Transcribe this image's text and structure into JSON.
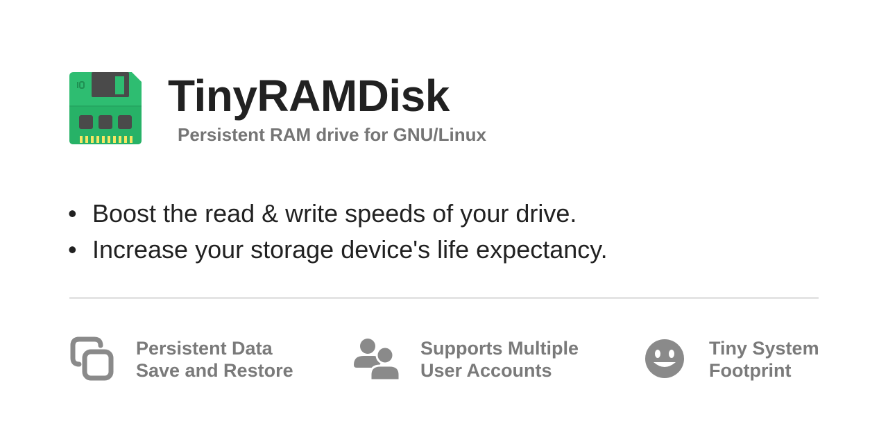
{
  "app": {
    "title": "TinyRAMDisk",
    "subtitle": "Persistent RAM drive for GNU/Linux",
    "logo_icon": "ram-disk-icon"
  },
  "bullets": [
    "Boost the read & write speeds of your drive.",
    "Increase your storage device's life expectancy."
  ],
  "bullet_marker": "•",
  "features": [
    {
      "icon": "copy-icon",
      "line1": "Persistent Data",
      "line2": "Save and Restore"
    },
    {
      "icon": "users-icon",
      "line1": "Supports Multiple",
      "line2": "User Accounts"
    },
    {
      "icon": "smiley-icon",
      "line1": "Tiny System",
      "line2": "Footprint"
    }
  ],
  "colors": {
    "brand_green": "#2ebd71",
    "chip_dark": "#4a4a4a",
    "contact_yellow": "#f5e663",
    "text_dark": "#212121",
    "text_muted": "#757575",
    "icon_gray": "#8a8a8a",
    "divider": "#e4e4e4"
  }
}
